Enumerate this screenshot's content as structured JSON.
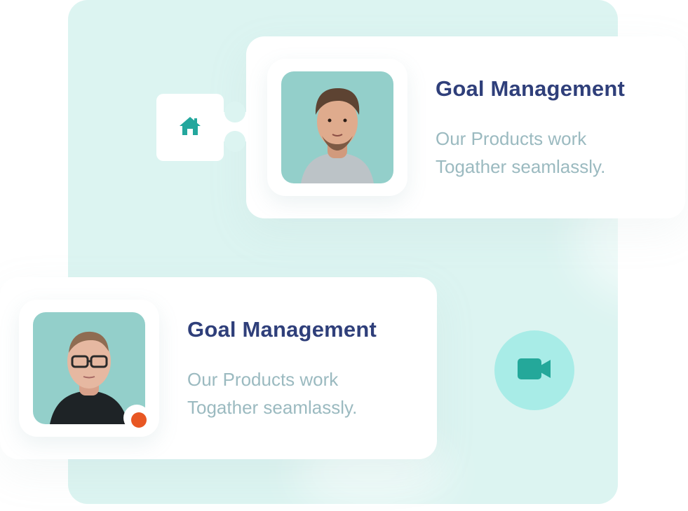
{
  "colors": {
    "background_panel": "#dcf4f1",
    "card_background": "#ffffff",
    "title_color": "#2f3f7a",
    "description_color": "#9bbac0",
    "avatar_background": "#93cfca",
    "accent": "#23a79d",
    "status_online": "#e85723",
    "video_button": "#a8ece7"
  },
  "icons": {
    "home": "home-icon",
    "video": "video-camera-icon"
  },
  "cards": [
    {
      "title": "Goal Management",
      "description_line_1": "Our Products work",
      "description_line_2": "Togather seamlassly."
    },
    {
      "title": "Goal Management",
      "description_line_1": "Our Products work",
      "description_line_2": "Togather seamlassly."
    }
  ]
}
